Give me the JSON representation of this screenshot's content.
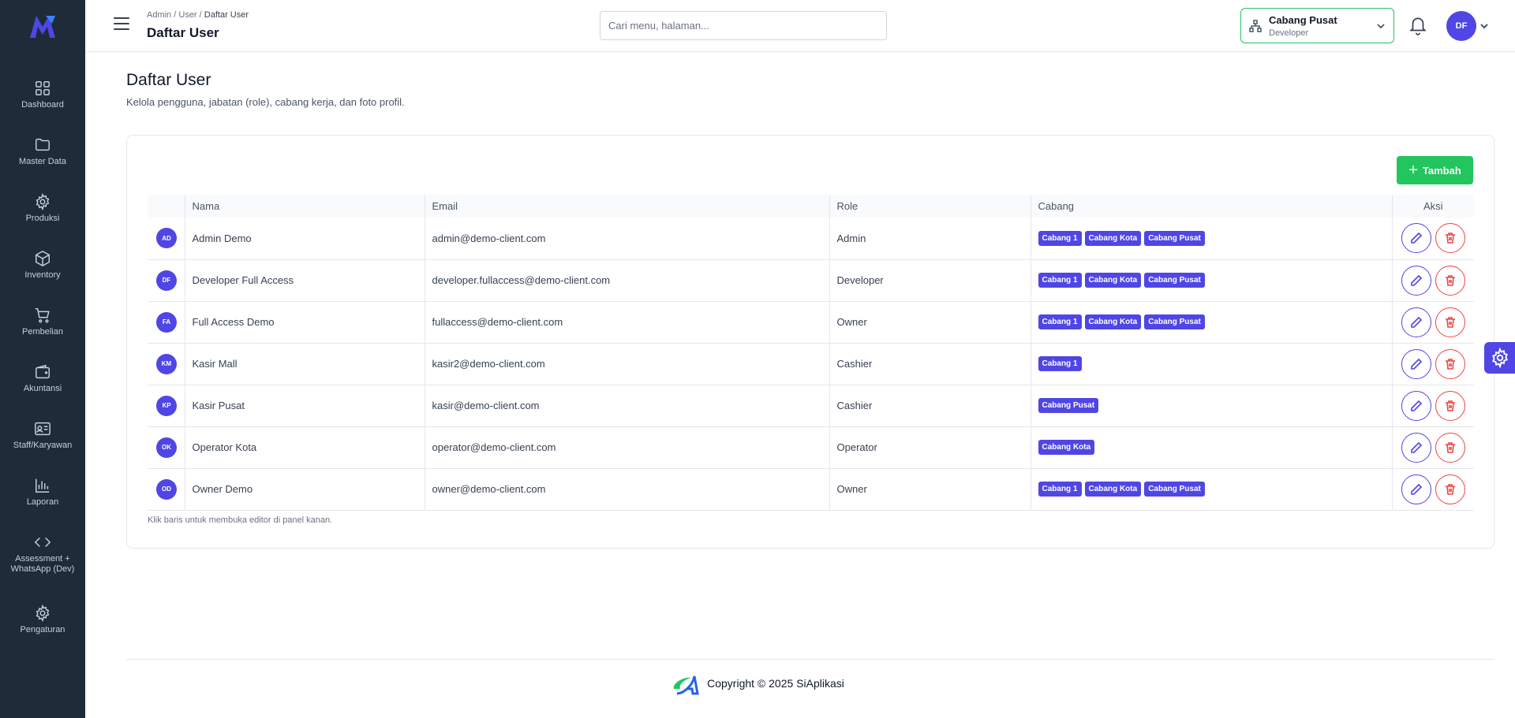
{
  "sidebar": {
    "items": [
      {
        "label": "Dashboard",
        "icon": "grid-icon"
      },
      {
        "label": "Master Data",
        "icon": "folder-icon"
      },
      {
        "label": "Produksi",
        "icon": "gear-icon"
      },
      {
        "label": "Inventory",
        "icon": "box-icon"
      },
      {
        "label": "Pembelian",
        "icon": "cart-icon"
      },
      {
        "label": "Akuntansi",
        "icon": "wallet-icon"
      },
      {
        "label": "Staff/Karyawan",
        "icon": "id-card-icon"
      },
      {
        "label": "Laporan",
        "icon": "bar-chart-icon"
      },
      {
        "label": "Assessment + WhatsApp (Dev)",
        "icon": "code-icon"
      },
      {
        "label": "Pengaturan",
        "icon": "gear-icon"
      }
    ]
  },
  "header": {
    "breadcrumb": {
      "part1": "Admin",
      "sep": "/",
      "part2": "User",
      "current": "Daftar User"
    },
    "title": "Daftar User",
    "search_placeholder": "Cari menu, halaman...",
    "branch": {
      "name": "Cabang Pusat",
      "role": "Developer"
    },
    "user_initials": "DF"
  },
  "page": {
    "title": "Daftar User",
    "subtitle": "Kelola pengguna, jabatan (role), cabang kerja, dan foto profil.",
    "add_label": "Tambah",
    "hint": "Klik baris untuk membuka editor di panel kanan."
  },
  "table": {
    "columns": {
      "name": "Nama",
      "email": "Email",
      "role": "Role",
      "branch": "Cabang",
      "actions": "Aksi"
    },
    "rows": [
      {
        "initials": "AD",
        "name": "Admin Demo",
        "email": "admin@demo-client.com",
        "role": "Admin",
        "branches": [
          "Cabang 1",
          "Cabang Kota",
          "Cabang Pusat"
        ]
      },
      {
        "initials": "DF",
        "name": "Developer Full Access",
        "email": "developer.fullaccess@demo-client.com",
        "role": "Developer",
        "branches": [
          "Cabang 1",
          "Cabang Kota",
          "Cabang Pusat"
        ]
      },
      {
        "initials": "FA",
        "name": "Full Access Demo",
        "email": "fullaccess@demo-client.com",
        "role": "Owner",
        "branches": [
          "Cabang 1",
          "Cabang Kota",
          "Cabang Pusat"
        ]
      },
      {
        "initials": "KM",
        "name": "Kasir Mall",
        "email": "kasir2@demo-client.com",
        "role": "Cashier",
        "branches": [
          "Cabang 1"
        ]
      },
      {
        "initials": "KP",
        "name": "Kasir Pusat",
        "email": "kasir@demo-client.com",
        "role": "Cashier",
        "branches": [
          "Cabang Pusat"
        ]
      },
      {
        "initials": "OK",
        "name": "Operator Kota",
        "email": "operator@demo-client.com",
        "role": "Operator",
        "branches": [
          "Cabang Kota"
        ]
      },
      {
        "initials": "OD",
        "name": "Owner Demo",
        "email": "owner@demo-client.com",
        "role": "Owner",
        "branches": [
          "Cabang 1",
          "Cabang Kota",
          "Cabang Pusat"
        ]
      }
    ]
  },
  "footer": {
    "copyright": "Copyright © 2025 SiAplikasi"
  },
  "colors": {
    "primary": "#4f46e5",
    "success": "#22c55e",
    "danger": "#ef4444",
    "sidebar": "#1e2b38"
  }
}
